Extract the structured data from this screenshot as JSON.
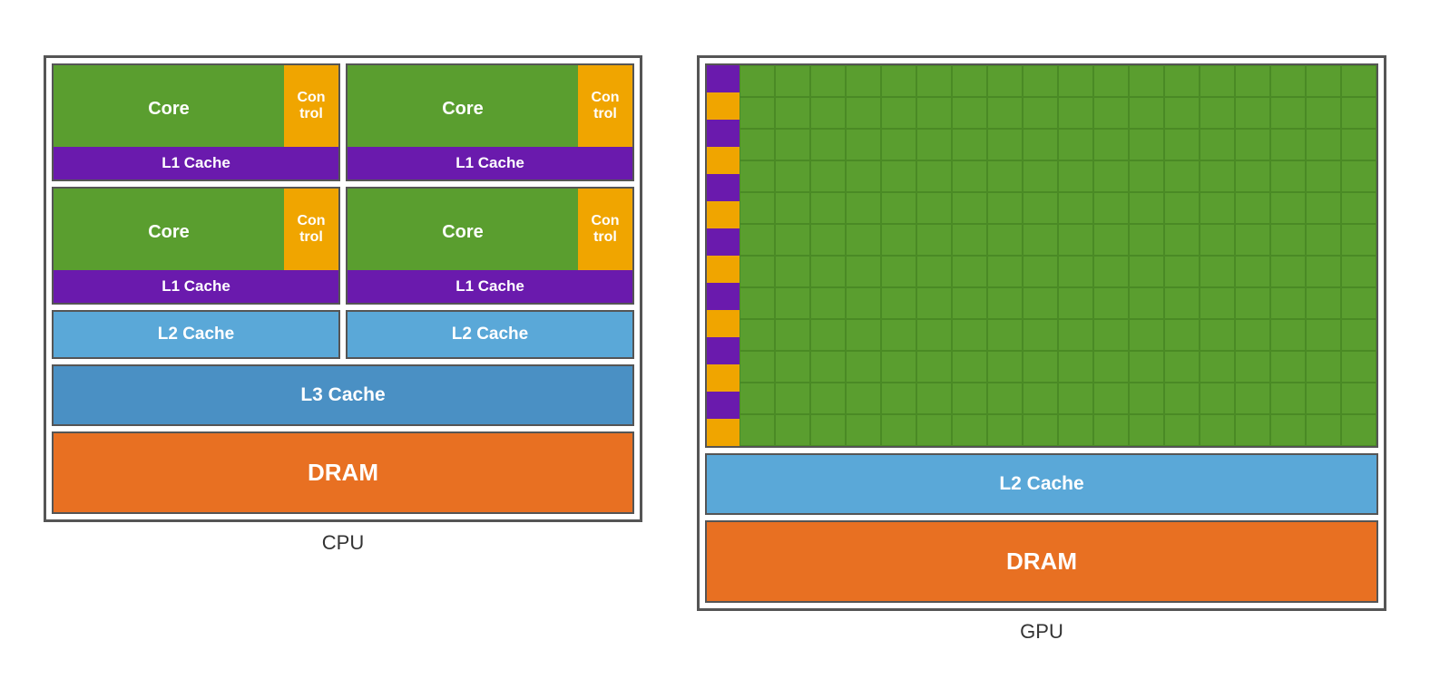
{
  "cpu": {
    "label": "CPU",
    "cores": [
      {
        "core_label": "Core",
        "control_label": "Con\ntrol",
        "l1_label": "L1 Cache"
      },
      {
        "core_label": "Core",
        "control_label": "Con\ntrol",
        "l1_label": "L1 Cache"
      },
      {
        "core_label": "Core",
        "control_label": "Con\ntrol",
        "l1_label": "L1 Cache"
      },
      {
        "core_label": "Core",
        "control_label": "Con\ntrol",
        "l1_label": "L1 Cache"
      }
    ],
    "l2_label": "L2 Cache",
    "l3_label": "L3  Cache",
    "dram_label": "DRAM"
  },
  "gpu": {
    "label": "GPU",
    "l2_label": "L2 Cache",
    "dram_label": "DRAM",
    "grid_cols": 18,
    "grid_rows": 12,
    "strip_segments": 14,
    "colors": {
      "purple": "#6a1aad",
      "orange": "#f0a500",
      "green": "#5a9e2f"
    }
  },
  "colors": {
    "green": "#5a9e2f",
    "orange_control": "#f0a500",
    "purple": "#6a1aad",
    "blue_light": "#5aa8d8",
    "blue_medium": "#4a90c4",
    "orange_dram": "#e87022"
  }
}
